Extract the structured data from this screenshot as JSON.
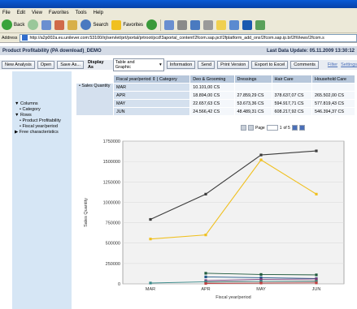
{
  "menu": [
    "File",
    "Edit",
    "View",
    "Favorites",
    "Tools",
    "Help"
  ],
  "toolbar": {
    "back": "Back",
    "search": "Search",
    "favorites": "Favorites"
  },
  "address": {
    "label": "Address",
    "url": "http://a2p002a.eu.unilever.com:53100/irj/servlet/prt/portal/prtroot/pcd!3aportal_content!2fcom.sap.pct!2fplatform_add_ons!2fcom.sap.ip.bi!2fiViews!2fcom.s"
  },
  "app": {
    "title": "Product Profitability (PA download)_DEMO",
    "last_update": "Last Data Update: 05.11.2009 13:30:12"
  },
  "appbar": {
    "new_analysis": "New Analysis",
    "open": "Open",
    "save_as": "Save As...",
    "display_as_label": "Display As",
    "display_as_value": "Table and Graphic",
    "information": "Information",
    "send": "Send",
    "print_version": "Print Version",
    "export": "Export to Excel",
    "comments": "Comments",
    "filter": "Filter",
    "settings": "Settings"
  },
  "sidebar": {
    "columns": "Columns",
    "category": "Category",
    "rows": "Rows",
    "product_profitability": "Product Profitability",
    "fiscal_year_period": "Fiscal year/period",
    "free_characteristics": "Free characteristics"
  },
  "table": {
    "corner": "Fiscal year/period ⇕ | Category",
    "headers": [
      "Deo & Grooming",
      "Dressings",
      "Hair Care",
      "Household Care"
    ],
    "measure": "Sales Quantity",
    "rows": [
      {
        "period": "MAR",
        "values": [
          "10.101,00 CS",
          "",
          "",
          ""
        ]
      },
      {
        "period": "APR",
        "values": [
          "18.894,00 CS",
          "27.859,29 CS",
          "378.637,07 CS",
          "265.502,00 CS"
        ]
      },
      {
        "period": "MAY",
        "values": [
          "22.657,63 CS",
          "53.673,36 CS",
          "594.917,71 CS",
          "577.819,43 CS"
        ]
      },
      {
        "period": "JUN",
        "values": [
          "24.566,42 CS",
          "48.489,31 CS",
          "608.217,92 CS",
          "546.394,37 CS"
        ]
      }
    ]
  },
  "pager": {
    "label": "Page",
    "current": "1",
    "of": "of 5"
  },
  "chart_data": {
    "type": "line",
    "categories": [
      "MAR",
      "APR",
      "MAY",
      "JUN"
    ],
    "xlabel": "Fiscal year/period",
    "ylabel": "Sales Quantity",
    "ylim": [
      0,
      1750000
    ],
    "yticks": [
      "0",
      "250000",
      "500000",
      "750000",
      "1000000",
      "1250000",
      "1500000",
      "1750000"
    ],
    "grid": true,
    "series": [
      {
        "color": "#3c3c3c",
        "values": [
          790000,
          1100000,
          1580000,
          1630000
        ]
      },
      {
        "color": "#f0c020",
        "values": [
          550000,
          600000,
          1520000,
          1100000
        ]
      },
      {
        "color": "#1f5a3c",
        "values": [
          null,
          130000,
          115000,
          110000
        ]
      },
      {
        "color": "#1f5a8a",
        "values": [
          null,
          85000,
          75000,
          65000
        ]
      },
      {
        "color": "#7a3a7a",
        "values": [
          null,
          40000,
          55000,
          60000
        ]
      },
      {
        "color": "#8a4a3a",
        "values": [
          null,
          20000,
          30000,
          35000
        ]
      },
      {
        "color": "#3a8a8a",
        "values": [
          10000,
          25000,
          30000,
          30000
        ]
      },
      {
        "color": "#c04040",
        "values": [
          null,
          5000,
          10000,
          12000
        ]
      }
    ]
  }
}
